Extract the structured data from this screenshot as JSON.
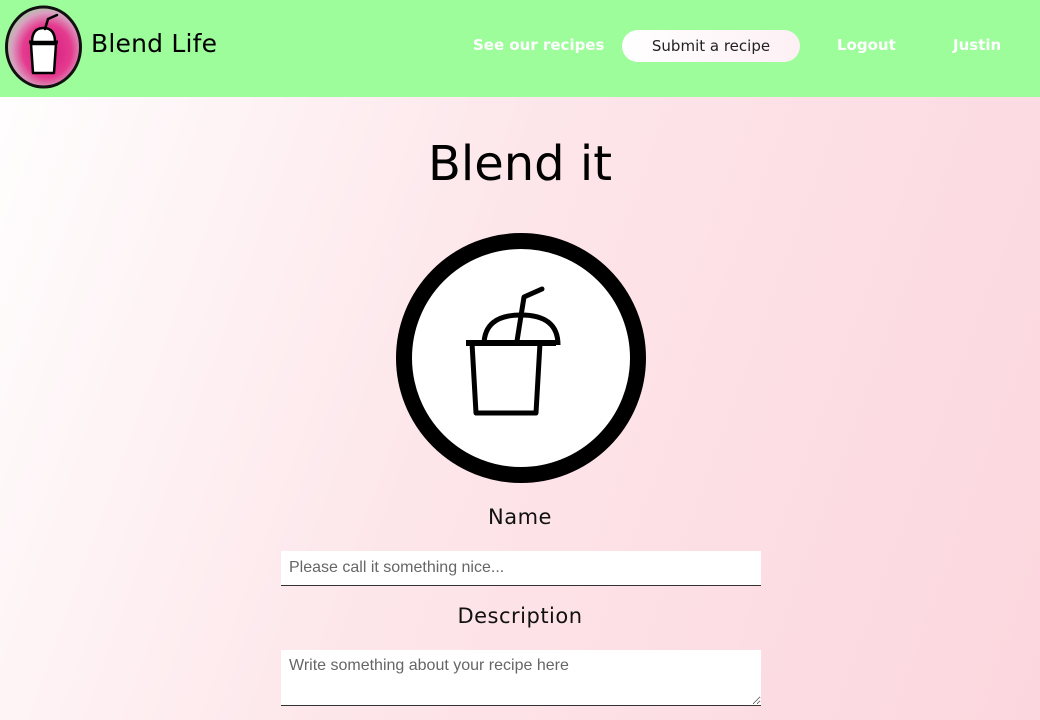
{
  "header": {
    "brand": "Blend Life",
    "logo_icon": "smoothie-cup-icon",
    "nav": {
      "recipes": "See our recipes",
      "submit": "Submit a recipe",
      "logout": "Logout",
      "user": "Justin"
    }
  },
  "main": {
    "title": "Blend it",
    "image_icon": "smoothie-cup-icon",
    "form": {
      "name_label": "Name",
      "name_placeholder": "Please call it something nice...",
      "description_label": "Description",
      "description_placeholder": "Write something about your recipe here"
    }
  },
  "colors": {
    "navbar": "#9dfd9b",
    "accent_pink": "#e5157a",
    "background": "#fde6ea"
  }
}
